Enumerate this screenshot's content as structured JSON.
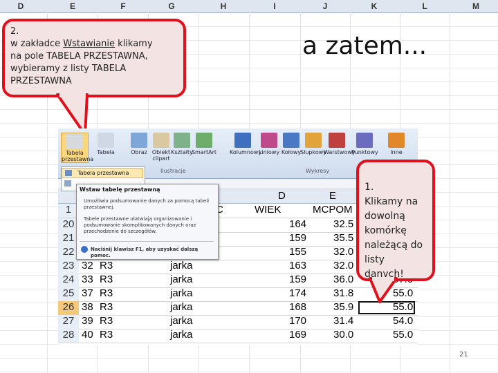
{
  "bg_sheet": {
    "columns": [
      "D",
      "E",
      "F",
      "G",
      "H",
      "I",
      "J",
      "K",
      "L",
      "M"
    ]
  },
  "callout_top": {
    "number": "2.",
    "line1_prefix": "w zakładce ",
    "line1_link": "Wstawianie",
    "line1_suffix": " klikamy",
    "line2": "na pole TABELA PRZESTAWNA,",
    "line3": "wybieramy z listy TABELA",
    "line4": "PRZESTAWNA"
  },
  "heading": "a zatem...",
  "callout_right": {
    "number": "1.",
    "lines": [
      "Klikamy na",
      "dowolną",
      "komórkę",
      "należącą do",
      "listy danych!"
    ]
  },
  "ribbon": {
    "buttons": [
      {
        "label": "Tabela\nprzestawna",
        "icon": "pivot-table-icon"
      },
      {
        "label": "Tabela",
        "icon": "table-icon"
      },
      {
        "label": "Obraz",
        "icon": "picture-icon"
      },
      {
        "label": "Obiekt\nclipart",
        "icon": "clipart-icon"
      },
      {
        "label": "Kształty",
        "icon": "shapes-icon"
      },
      {
        "label": "SmartArt",
        "icon": "smartart-icon"
      },
      {
        "label": "Kolumnowy",
        "icon": "column-chart-icon"
      },
      {
        "label": "Liniowy",
        "icon": "line-chart-icon"
      },
      {
        "label": "Kołowy",
        "icon": "pie-chart-icon"
      },
      {
        "label": "Słupkowy",
        "icon": "bar-chart-icon"
      },
      {
        "label": "Warstwowy",
        "icon": "area-chart-icon"
      },
      {
        "label": "Punktowy",
        "icon": "scatter-chart-icon"
      },
      {
        "label": "Inne",
        "icon": "other-charts-icon"
      }
    ],
    "groups": [
      "Ilustracje",
      "Wykresy"
    ]
  },
  "menu": {
    "item": "Tabela przestawna"
  },
  "tooltip": {
    "title": "Wstaw tabelę przestawną",
    "body1": "Umożliwia podsumowanie danych za pomocą tabeli przestawnej.",
    "body2": "Tabele przestawne ułatwiają organizowanie i podsumowanie skomplikowanych danych oraz przechodzenie do szczegółów.",
    "help": "Naciśnij klawisz F1, aby uzyskać dalszą pomoc."
  },
  "sheet": {
    "col_headers": [
      "D",
      "E"
    ],
    "header_row": {
      "num": "1",
      "c": "C",
      "d": "WIEK",
      "e": "MCPOM"
    },
    "rows": [
      {
        "num": "20",
        "a": "",
        "b": "",
        "c": "",
        "d": "164",
        "e": "32.5",
        "f": ""
      },
      {
        "num": "21",
        "a": "",
        "b": "",
        "c": "",
        "d": "159",
        "e": "35.5",
        "f": ""
      },
      {
        "num": "22",
        "a": "",
        "b": "",
        "c": "",
        "d": "155",
        "e": "32.0",
        "f": ""
      },
      {
        "num": "23",
        "a": "32",
        "b": "R3",
        "c": "jarka",
        "d": "163",
        "e": "32.0",
        "f": ""
      },
      {
        "num": "24",
        "a": "33",
        "b": "R3",
        "c": "jarka",
        "d": "159",
        "e": "36.0",
        "f": "57.0"
      },
      {
        "num": "25",
        "a": "37",
        "b": "R3",
        "c": "jarka",
        "d": "174",
        "e": "31.8",
        "f": "55.0"
      },
      {
        "num": "26",
        "a": "38",
        "b": "R3",
        "c": "jarka",
        "d": "168",
        "e": "35.9",
        "f": "55.0"
      },
      {
        "num": "27",
        "a": "39",
        "b": "R3",
        "c": "jarka",
        "d": "170",
        "e": "31.4",
        "f": "54.0"
      },
      {
        "num": "28",
        "a": "40",
        "b": "R3",
        "c": "jarka",
        "d": "169",
        "e": "30.0",
        "f": "55.0"
      }
    ]
  },
  "slide_number": "21"
}
